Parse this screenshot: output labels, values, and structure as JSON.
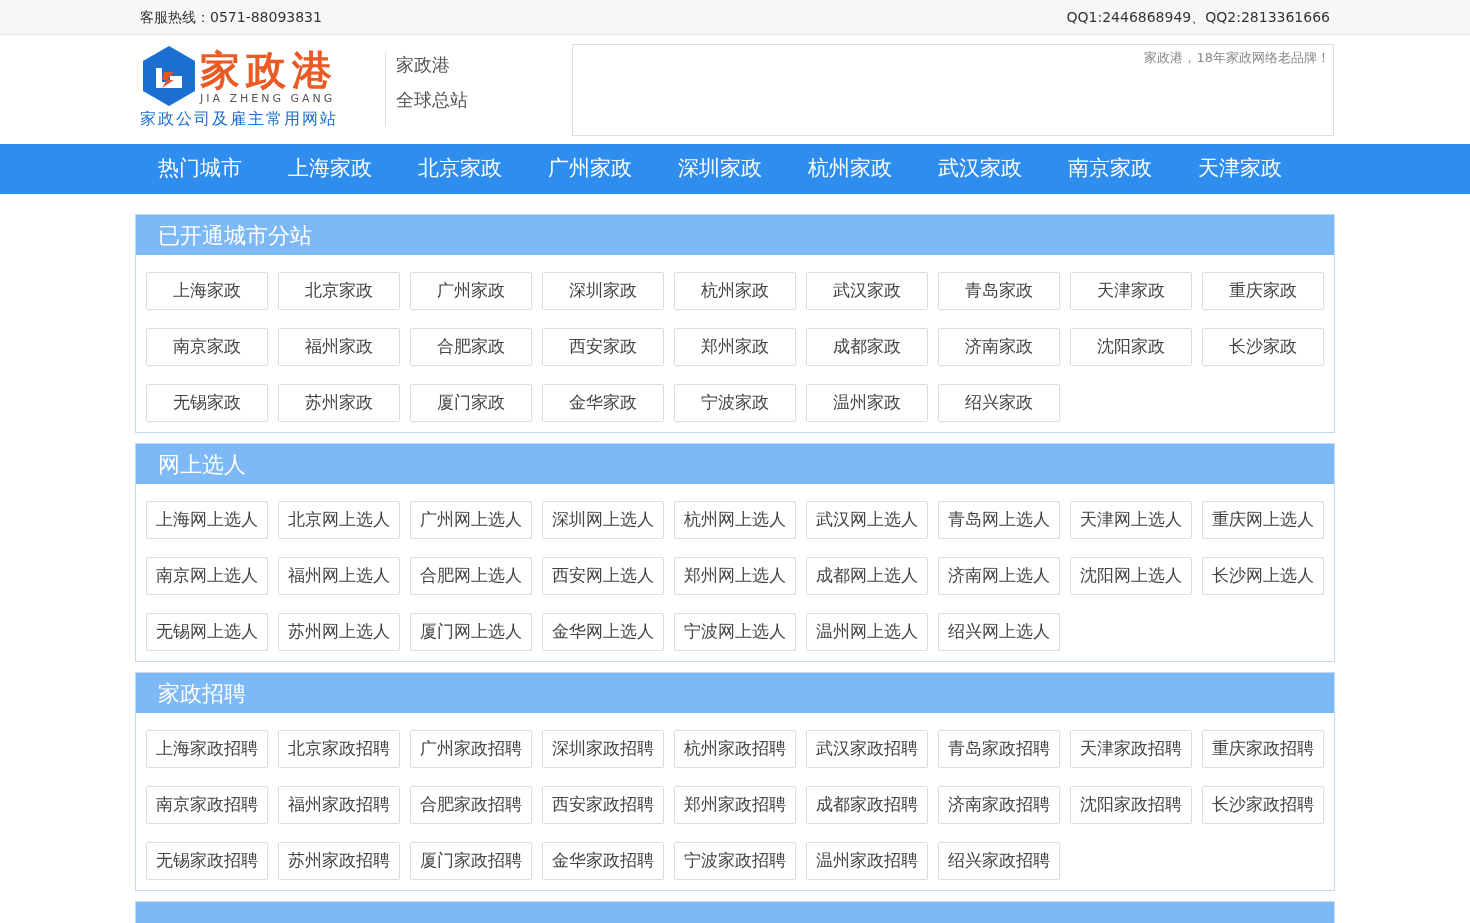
{
  "top_bar": {
    "hotline": "客服热线：0571-88093831",
    "qq": "QQ1:2446868949、QQ2:2813361666"
  },
  "logo": {
    "name": "家政港",
    "pinyin": "JIA ZHENG GANG",
    "slogan": "家政公司及雇主常用网站"
  },
  "site_label": [
    "家政港",
    "全球总站"
  ],
  "banner": {
    "text": "家政港，18年家政网络老品牌！"
  },
  "nav": [
    "热门城市",
    "上海家政",
    "北京家政",
    "广州家政",
    "深圳家政",
    "杭州家政",
    "武汉家政",
    "南京家政",
    "天津家政"
  ],
  "sections": [
    {
      "title": "已开通城市分站",
      "items": [
        "上海家政",
        "北京家政",
        "广州家政",
        "深圳家政",
        "杭州家政",
        "武汉家政",
        "青岛家政",
        "天津家政",
        "重庆家政",
        "南京家政",
        "福州家政",
        "合肥家政",
        "西安家政",
        "郑州家政",
        "成都家政",
        "济南家政",
        "沈阳家政",
        "长沙家政",
        "无锡家政",
        "苏州家政",
        "厦门家政",
        "金华家政",
        "宁波家政",
        "温州家政",
        "绍兴家政"
      ]
    },
    {
      "title": "网上选人",
      "items": [
        "上海网上选人",
        "北京网上选人",
        "广州网上选人",
        "深圳网上选人",
        "杭州网上选人",
        "武汉网上选人",
        "青岛网上选人",
        "天津网上选人",
        "重庆网上选人",
        "南京网上选人",
        "福州网上选人",
        "合肥网上选人",
        "西安网上选人",
        "郑州网上选人",
        "成都网上选人",
        "济南网上选人",
        "沈阳网上选人",
        "长沙网上选人",
        "无锡网上选人",
        "苏州网上选人",
        "厦门网上选人",
        "金华网上选人",
        "宁波网上选人",
        "温州网上选人",
        "绍兴网上选人"
      ]
    },
    {
      "title": "家政招聘",
      "items": [
        "上海家政招聘",
        "北京家政招聘",
        "广州家政招聘",
        "深圳家政招聘",
        "杭州家政招聘",
        "武汉家政招聘",
        "青岛家政招聘",
        "天津家政招聘",
        "重庆家政招聘",
        "南京家政招聘",
        "福州家政招聘",
        "合肥家政招聘",
        "西安家政招聘",
        "郑州家政招聘",
        "成都家政招聘",
        "济南家政招聘",
        "沈阳家政招聘",
        "长沙家政招聘",
        "无锡家政招聘",
        "苏州家政招聘",
        "厦门家政招聘",
        "金华家政招聘",
        "宁波家政招聘",
        "温州家政招聘",
        "绍兴家政招聘"
      ]
    }
  ]
}
